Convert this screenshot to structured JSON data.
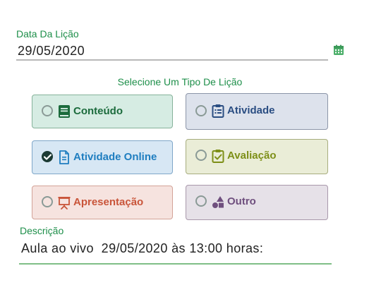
{
  "date_field": {
    "label": "Data Da Lição",
    "value": "29/05/2020",
    "icon": "calendar-icon"
  },
  "lesson_type": {
    "title": "Selecione Um Tipo De Lição",
    "selected": "Atividade Online",
    "options": [
      {
        "label": "Conteúdo",
        "icon": "book-icon",
        "color": "#1b6b3c",
        "checked": false
      },
      {
        "label": "Atividade",
        "icon": "clipboard-list-icon",
        "color": "#2a4d82",
        "checked": false
      },
      {
        "label": "Atividade Online",
        "icon": "file-text-icon",
        "color": "#1f7ec0",
        "checked": true
      },
      {
        "label": "Avaliação",
        "icon": "clipboard-check-icon",
        "color": "#7d8f17",
        "checked": false
      },
      {
        "label": "Apresentação",
        "icon": "presentation-icon",
        "color": "#c9553a",
        "checked": false
      },
      {
        "label": "Outro",
        "icon": "shapes-icon",
        "color": "#6f4f7e",
        "checked": false
      }
    ]
  },
  "description": {
    "label": "Descrição",
    "value": "Aula ao vivo  29/05/2020 às 13:00 horas:"
  },
  "colors": {
    "accent_green": "#1e8f4a"
  }
}
